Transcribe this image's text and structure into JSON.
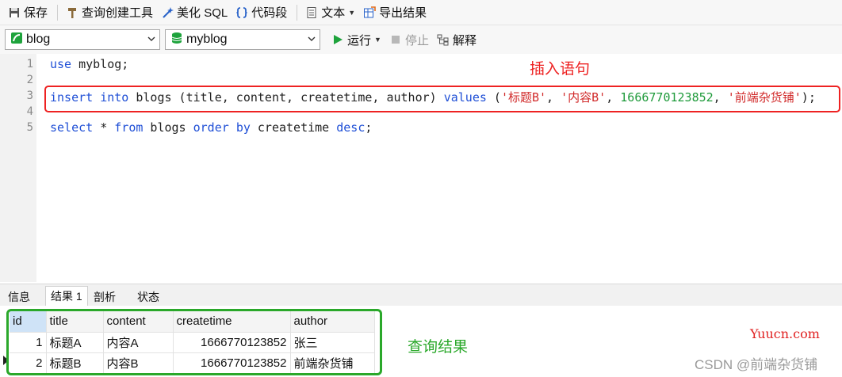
{
  "toolbar": {
    "save": "保存",
    "query_builder": "查询创建工具",
    "beautify": "美化 SQL",
    "snippet": "代码段",
    "text": "文本",
    "export": "导出结果"
  },
  "bar2": {
    "connection": "blog",
    "database": "myblog",
    "run": "运行",
    "stop": "停止",
    "explain": "解释"
  },
  "editor": {
    "line_numbers": [
      "1",
      "2",
      "3",
      "4",
      "5"
    ],
    "line1": {
      "kw": "use",
      "rest": " myblog;"
    },
    "line3": {
      "kw1": "insert",
      "kw2": "into",
      "mid": " blogs (title, content, createtime, author) ",
      "kw3": "values",
      "open": " (",
      "s1": "'标题B'",
      "c1": ", ",
      "s2": "'内容B'",
      "c2": ", ",
      "n1": "1666770123852",
      "c3": ", ",
      "s3": "'前端杂货铺'",
      "close": ");"
    },
    "line5": {
      "kw1": "select",
      "m1": " * ",
      "kw2": "from",
      "m2": " blogs ",
      "kw3": "order",
      "kw4": "by",
      "m3": " createtime ",
      "kw5": "desc",
      "end": ";"
    },
    "annotation_insert": "插入语句"
  },
  "results": {
    "tabs": [
      "信息",
      "结果 1",
      "剖析",
      "状态"
    ],
    "columns": [
      "id",
      "title",
      "content",
      "createtime",
      "author"
    ],
    "rows": [
      [
        "1",
        "标题A",
        "内容A",
        "1666770123852",
        "张三"
      ],
      [
        "2",
        "标题B",
        "内容B",
        "1666770123852",
        "前端杂货铺"
      ]
    ],
    "annotation_query": "查询结果"
  },
  "watermark": {
    "site": "Yuucn.com",
    "author": "CSDN @前端杂货铺"
  },
  "colors": {
    "keyword": "#1f4fd6",
    "string": "#d12a2a",
    "number": "#1e9a3a",
    "highlight_red": "#ee2222",
    "highlight_green": "#2aa82a"
  }
}
